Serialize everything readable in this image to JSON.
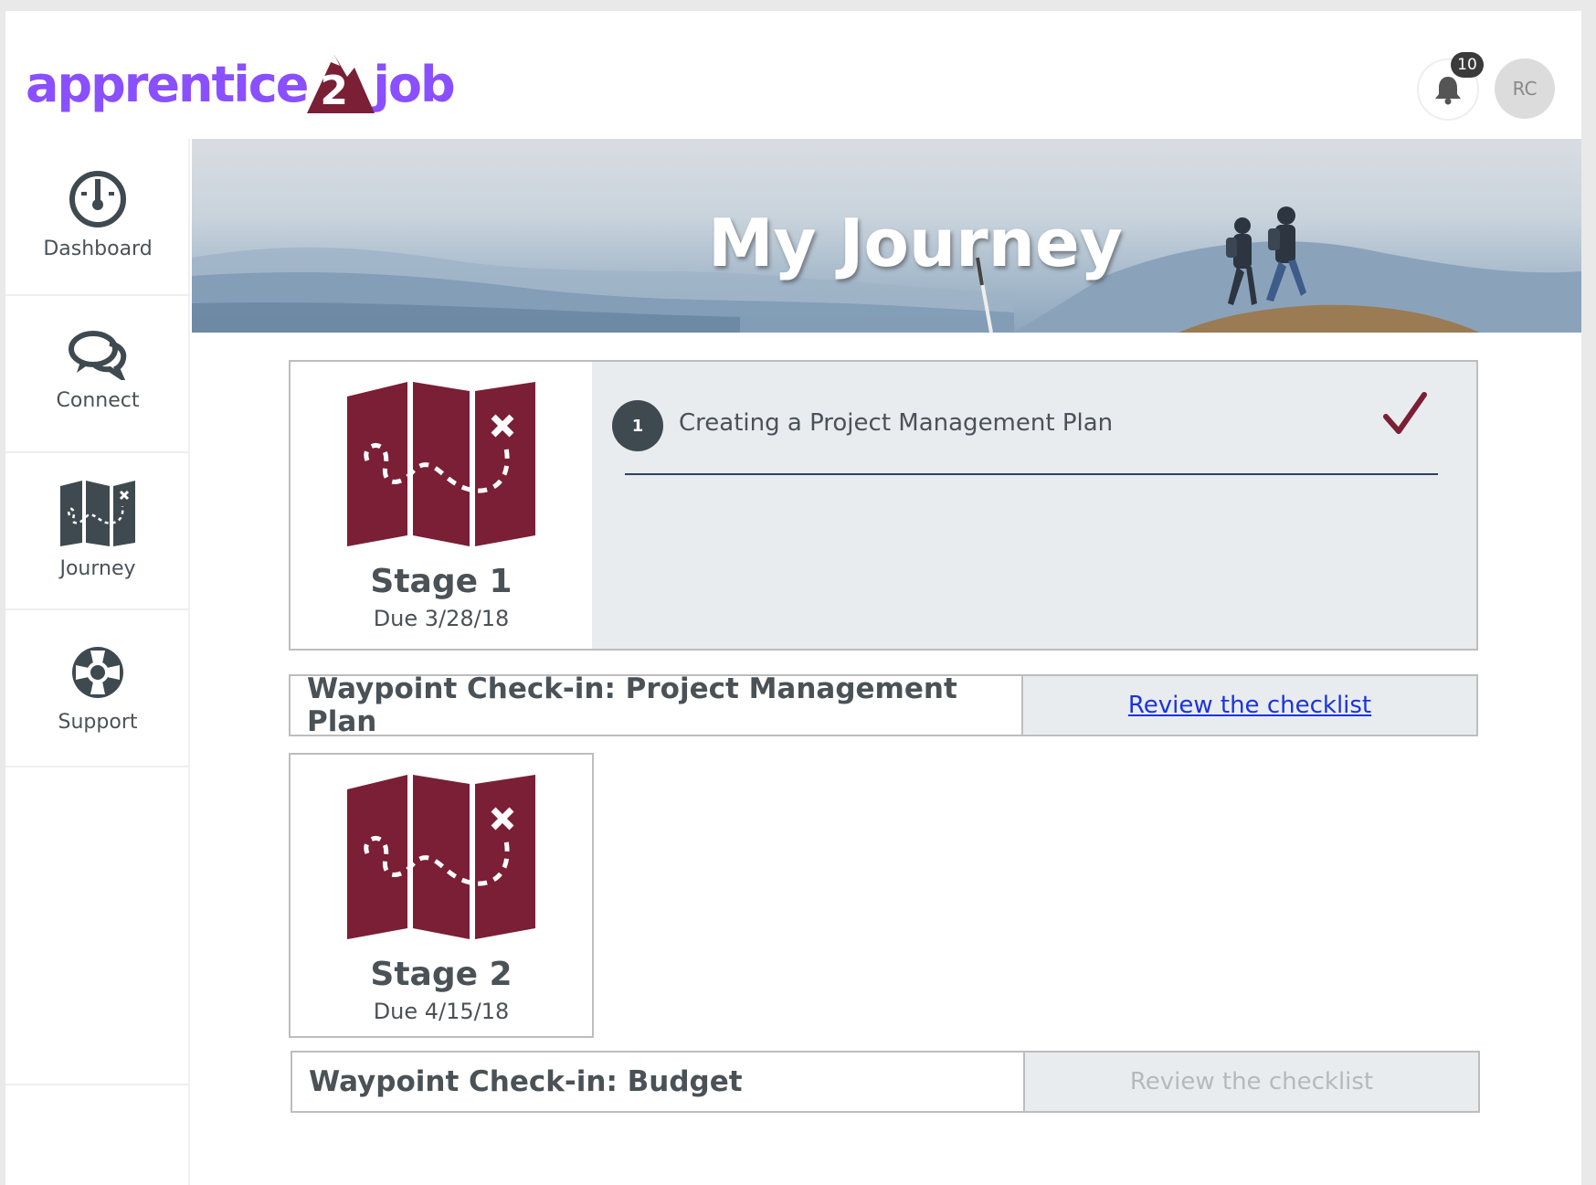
{
  "app": {
    "logo_left": "apprentice",
    "logo_mark_number": "2",
    "logo_right": "job",
    "brand_color": "#8a4fff",
    "accent_color": "#7a1f35"
  },
  "header": {
    "notification_count": "10",
    "avatar_initials": "RC"
  },
  "sidebar": {
    "items": [
      {
        "label": "Dashboard",
        "icon": "gauge-icon"
      },
      {
        "label": "Connect",
        "icon": "chat-bubbles-icon"
      },
      {
        "label": "Journey",
        "icon": "treasure-map-icon"
      },
      {
        "label": "Support",
        "icon": "lifebuoy-icon"
      }
    ]
  },
  "banner": {
    "title": "My Journey"
  },
  "stages": [
    {
      "title": "Stage 1",
      "due": "Due 3/28/18",
      "tasks": [
        {
          "number": "1",
          "label": "Creating a Project Management Plan",
          "completed": true
        }
      ],
      "waypoint": {
        "title": "Waypoint Check-in: Project Management Plan",
        "link": "Review the checklist",
        "enabled": true
      }
    },
    {
      "title": "Stage 2",
      "due": "Due 4/15/18",
      "tasks": [],
      "waypoint": {
        "title": "Waypoint Check-in: Budget",
        "link": "Review the checklist",
        "enabled": false
      }
    }
  ]
}
